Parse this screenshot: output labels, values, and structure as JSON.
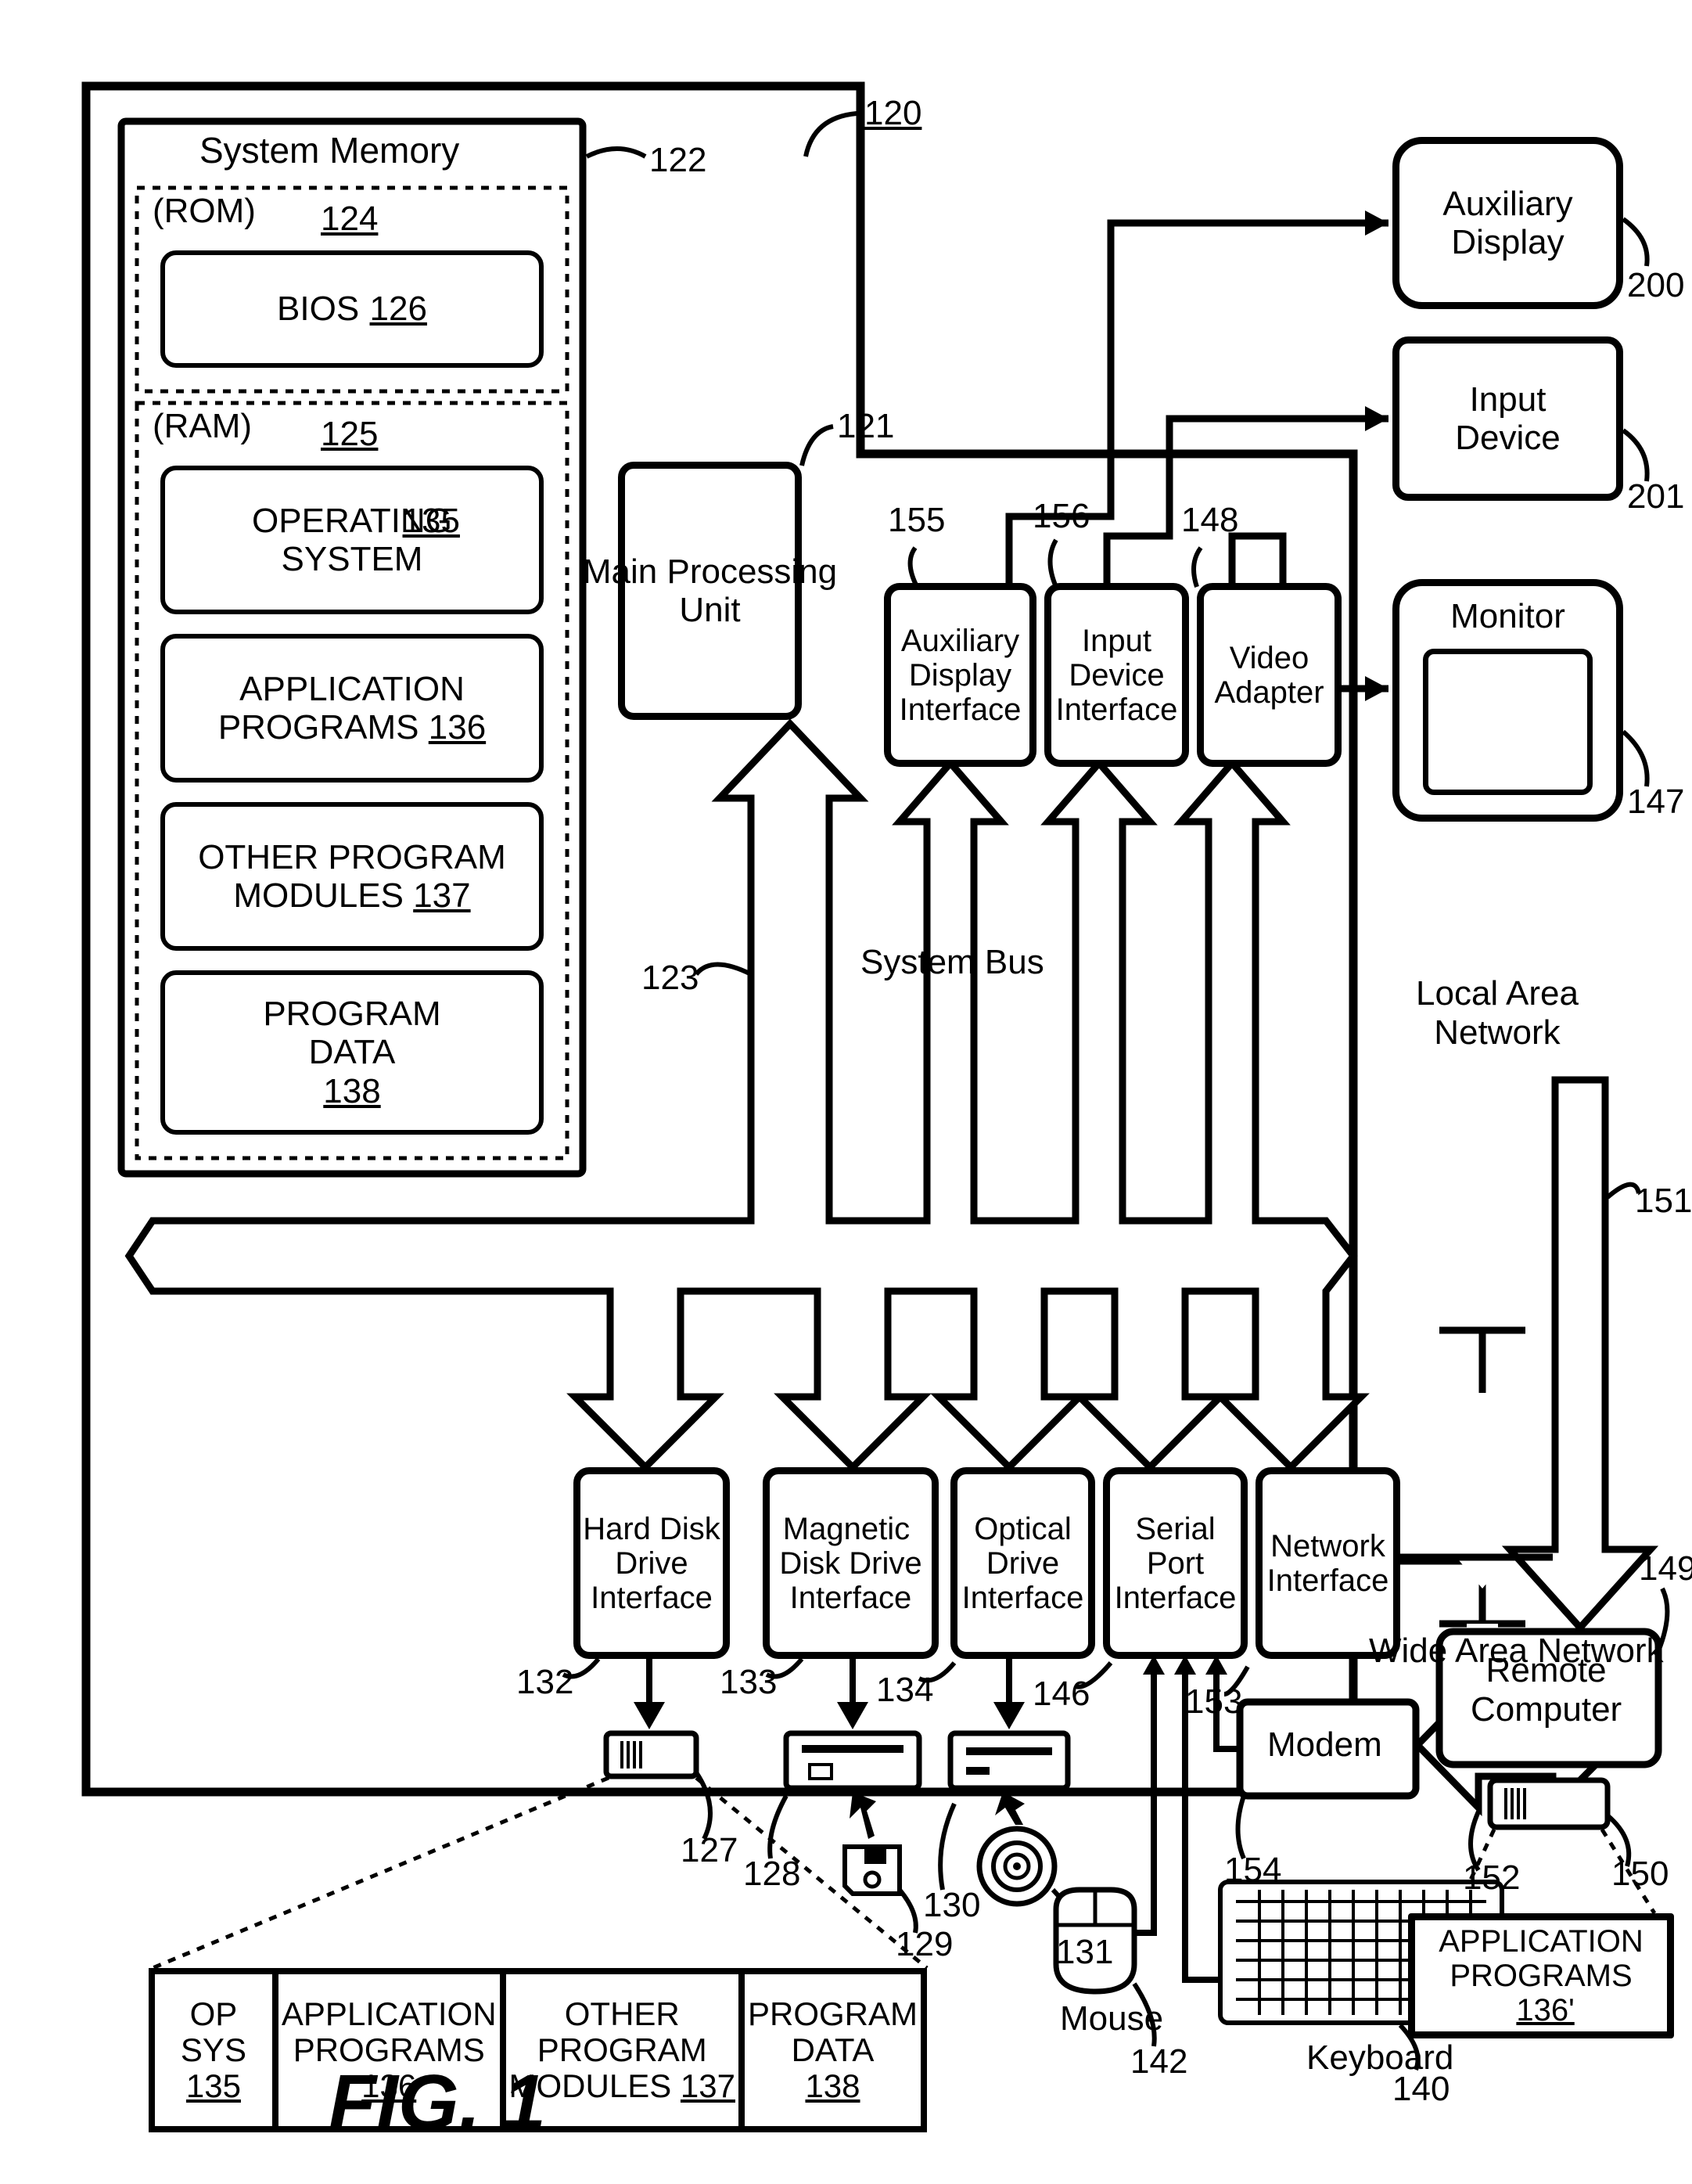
{
  "fig": "FIG. 1",
  "outer_ref": "120",
  "sys_mem": {
    "title": "System Memory",
    "title_ref": "122",
    "rom": "(ROM)",
    "rom_ref": "124",
    "bios": "BIOS",
    "bios_ref": "126",
    "ram": "(RAM)",
    "ram_ref": "125",
    "os": "OPERATING\nSYSTEM",
    "os_ref": "135",
    "app": "APPLICATION\nPROGRAMS",
    "app_ref": "136",
    "mods": "OTHER PROGRAM\nMODULES",
    "mods_ref": "137",
    "data": "PROGRAM\nDATA",
    "data_ref": "138"
  },
  "cpu": {
    "label": "Main Processing\nUnit",
    "ref": "121"
  },
  "bus": {
    "label": "System Bus",
    "ref": "123"
  },
  "aux_if": {
    "label": "Auxiliary\nDisplay\nInterface",
    "ref": "155"
  },
  "in_if": {
    "label": "Input\nDevice\nInterface",
    "ref": "156"
  },
  "vid": {
    "label": "Video\nAdapter",
    "ref": "148"
  },
  "hdi": {
    "label": "Hard Disk\nDrive\nInterface",
    "ref": "132"
  },
  "mdi": {
    "label": "Magnetic \nDisk Drive\nInterface",
    "ref": "133"
  },
  "odi": {
    "label": "Optical\nDrive\nInterface",
    "ref": "134"
  },
  "spi": {
    "label": "Serial\nPort\nInterface",
    "ref": "146"
  },
  "ni": {
    "label": "Network\nInterface",
    "ref": "153"
  },
  "modem": {
    "label": "Modem",
    "ref": "154"
  },
  "aux_disp": {
    "label": "Auxiliary\nDisplay",
    "ref": "200"
  },
  "in_dev": {
    "label": "Input\nDevice",
    "ref": "201"
  },
  "monitor": {
    "label": "Monitor",
    "ref": "147"
  },
  "lan": {
    "label": "Local Area\nNetwork",
    "ref": "151"
  },
  "wan": {
    "label": "Wide Area Network",
    "ref": "152"
  },
  "remote": {
    "label": "Remote\nComputer",
    "ref": "149"
  },
  "hdd": {
    "ref": "127"
  },
  "mdd": {
    "ref": "128",
    "disk_ref": "129"
  },
  "odd": {
    "ref": "130",
    "disc_ref": "131"
  },
  "kbd": {
    "label": "Keyboard",
    "ref": "140"
  },
  "mouse": {
    "label": "Mouse",
    "ref": "142"
  },
  "rstore": {
    "ref": "150"
  },
  "bottom_table": {
    "c1": "OP SYS",
    "c1_ref": "135",
    "c2": "APPLICATION\nPROGRAMS",
    "c2_ref": "136",
    "c3": "OTHER\nPROGRAM\nMODULES",
    "c3_ref": "137",
    "c4": "PROGRAM\nDATA",
    "c4_ref": "138"
  },
  "remote_app": {
    "label": "APPLICATION\nPROGRAMS",
    "ref": "136'"
  }
}
